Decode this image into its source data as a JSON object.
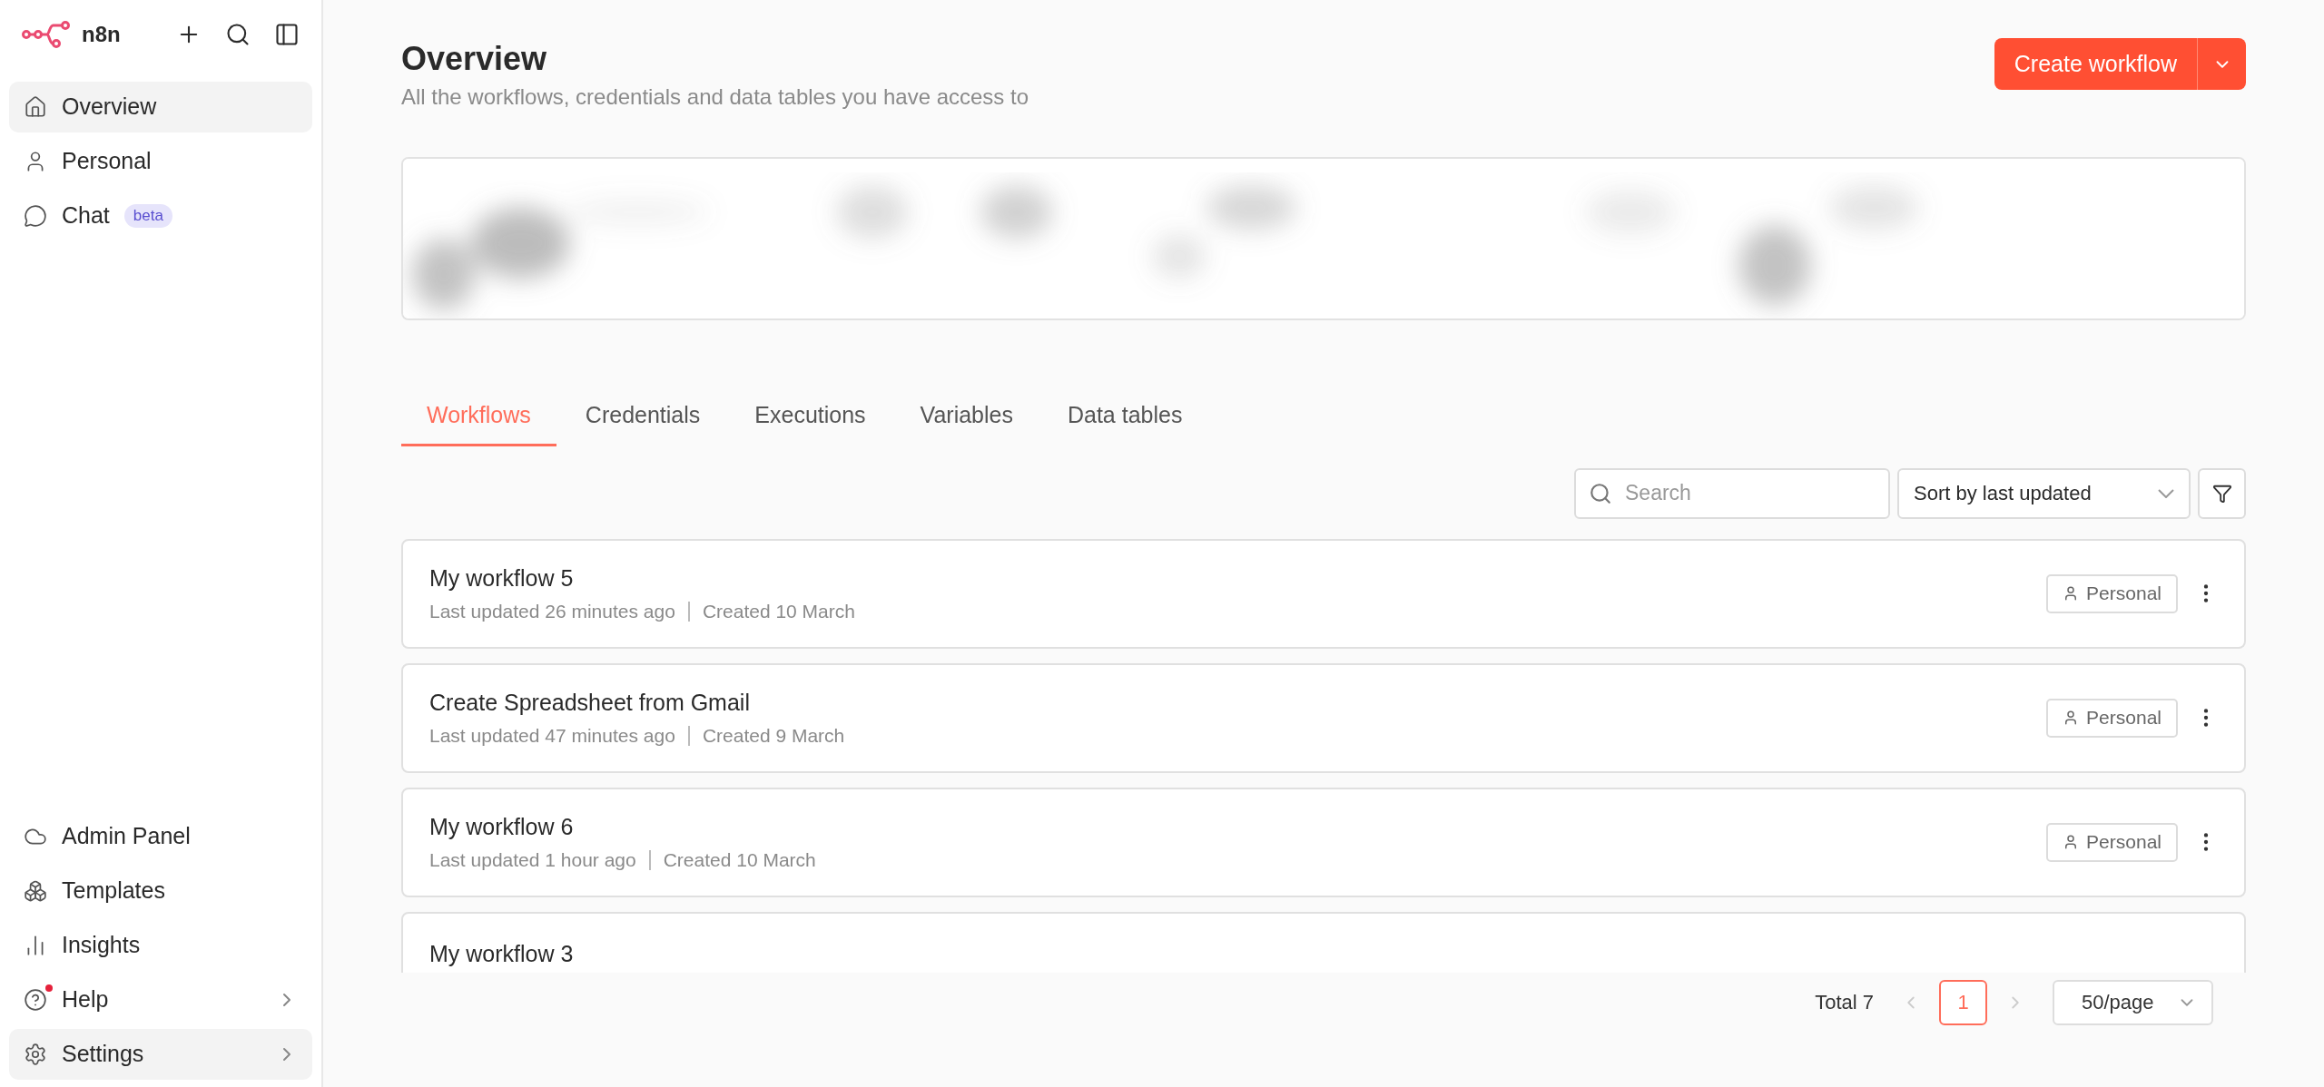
{
  "sidebar": {
    "brand": "n8n",
    "top_items": [
      {
        "label": "Overview",
        "selected": true
      },
      {
        "label": "Personal",
        "selected": false
      },
      {
        "label": "Chat",
        "selected": false,
        "badge": "beta"
      }
    ],
    "bottom_items": [
      {
        "label": "Admin Panel",
        "selected": false,
        "submenu": false,
        "notification": false
      },
      {
        "label": "Templates",
        "selected": false,
        "submenu": false,
        "notification": false
      },
      {
        "label": "Insights",
        "selected": false,
        "submenu": false,
        "notification": false
      },
      {
        "label": "Help",
        "selected": false,
        "submenu": true,
        "notification": true
      },
      {
        "label": "Settings",
        "selected": true,
        "submenu": true,
        "notification": false
      }
    ]
  },
  "header": {
    "title": "Overview",
    "subtitle": "All the workflows, credentials and data tables you have access to",
    "primary_button": "Create workflow"
  },
  "tabs": [
    {
      "label": "Workflows",
      "selected": true
    },
    {
      "label": "Credentials",
      "selected": false
    },
    {
      "label": "Executions",
      "selected": false
    },
    {
      "label": "Variables",
      "selected": false
    },
    {
      "label": "Data tables",
      "selected": false
    }
  ],
  "toolbar": {
    "search": {
      "placeholder": "Search"
    },
    "sort": "Sort by last updated"
  },
  "workflows": [
    {
      "name": "My workflow 5",
      "updated": "Last updated 26 minutes ago",
      "created": "Created 10 March",
      "owner": "Personal"
    },
    {
      "name": "Create Spreadsheet from Gmail",
      "updated": "Last updated 47 minutes ago",
      "created": "Created 9 March",
      "owner": "Personal"
    },
    {
      "name": "My workflow 6",
      "updated": "Last updated 1 hour ago",
      "created": "Created 10 March",
      "owner": "Personal"
    },
    {
      "name": "My workflow 3"
    }
  ],
  "pagination": {
    "total": "Total 7",
    "pages": [
      {
        "label": "1",
        "selected": true
      }
    ],
    "page_size": "50/page"
  }
}
